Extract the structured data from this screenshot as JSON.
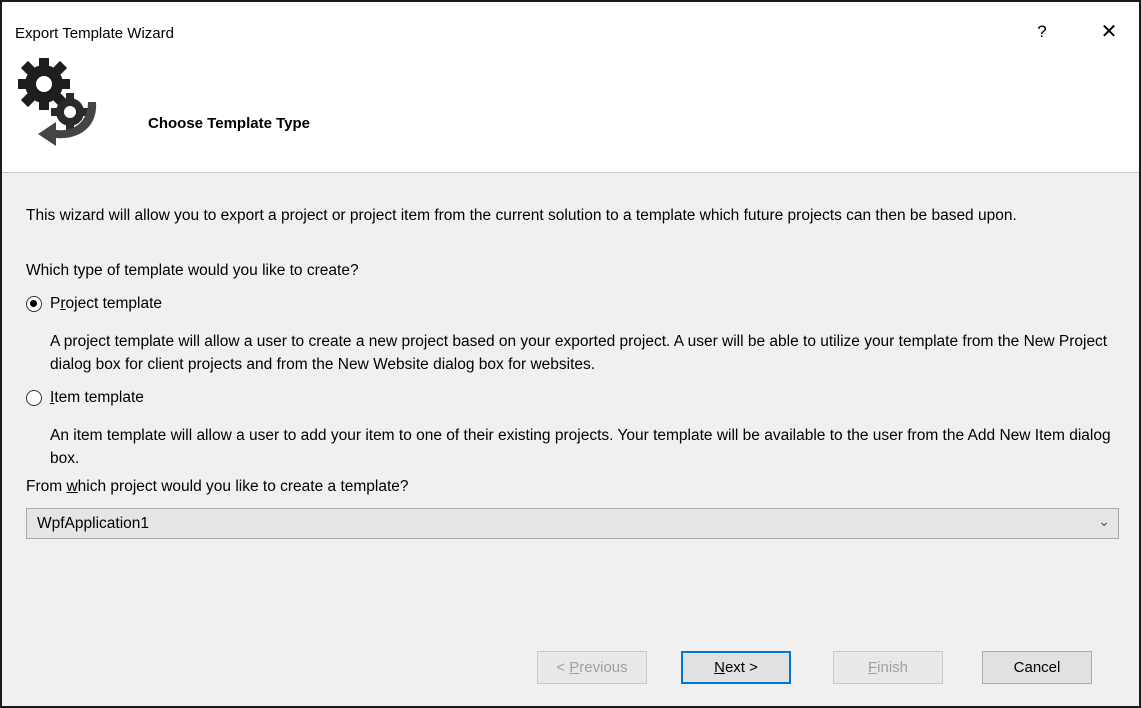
{
  "window": {
    "title": "Export Template Wizard",
    "help_label": "?",
    "close_label": "✕"
  },
  "header": {
    "title": "Choose Template Type"
  },
  "intro": {
    "text": "This wizard will allow you to export a project or project item from the current solution to a template which future projects can then be based upon.",
    "question": "Which type of template would you like to create?"
  },
  "options": {
    "project": {
      "label_pre": "P",
      "label_mnemonic": "r",
      "label_post": "oject template",
      "checked": true,
      "description": "A project template will allow a user to create a new project based on your exported project. A user will be able to utilize your template from the New Project dialog box for client projects and from the New Website dialog box for websites."
    },
    "item": {
      "label_mnemonic": "I",
      "label_post": "tem template",
      "checked": false,
      "description": "An item template will allow a user to add your item to one of their existing projects. Your template will be available to the user from the Add New Item dialog box."
    }
  },
  "project_select": {
    "label_pre": "From ",
    "label_mnemonic": "w",
    "label_post": "hich project would you like to create a template?",
    "value": "WpfApplication1"
  },
  "buttons": {
    "previous": {
      "label_pre": "< ",
      "label_mnemonic": "P",
      "label_post": "revious",
      "enabled": false
    },
    "next": {
      "label_mnemonic": "N",
      "label_post": "ext >",
      "enabled": true
    },
    "finish": {
      "label_mnemonic": "F",
      "label_post": "inish",
      "enabled": false
    },
    "cancel": {
      "label": "Cancel",
      "enabled": true
    }
  }
}
